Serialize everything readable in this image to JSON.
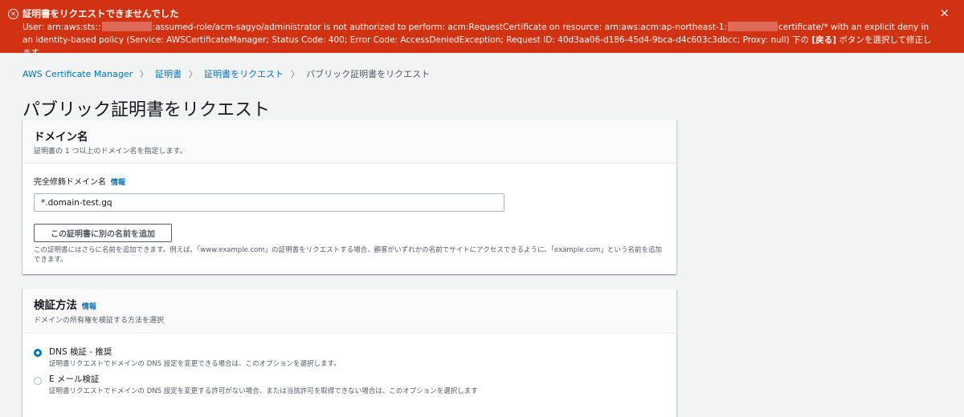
{
  "error_banner": {
    "title": "証明書をリクエストできませんでした",
    "msg_prefix": "User: arn:aws:sts::",
    "msg_mid": ":assumed-role/acm-sagyo/administrator is not authorized to perform: acm:RequestCertificate on resource: arn:aws:acm:ap-northeast-1:",
    "msg_rest": "certificate/* with an explicit deny in an identity-based policy (Service: AWSCertificateManager; Status Code: 400; Error Code: AccessDeniedException; Request ID: 40d3aa06-d186-45d4-9bca-d4c603c3dbcc; Proxy: null) 下の",
    "msg_back": "[戻る]",
    "msg_suffix": "ボタンを選択して修正します。",
    "close_icon": "×",
    "color": "#d13212"
  },
  "breadcrumb": {
    "items": [
      "AWS Certificate Manager",
      "証明書",
      "証明書をリクエスト"
    ],
    "current": "パブリック証明書をリクエスト",
    "separator": "〉"
  },
  "page": {
    "title": "パブリック証明書をリクエスト"
  },
  "domain_panel": {
    "title": "ドメイン名",
    "description": "証明書の 1 つ以上のドメイン名を指定します。",
    "field_label": "完全修飾ドメイン名",
    "info": "情報",
    "input_value": "*.domain-test.gq",
    "add_button": "この証明書に別の名前を追加",
    "help_text": "この証明書にはさらに名前を追加できます。例えば、「www.example.com」の証明書をリクエストする場合、顧客がいずれかの名前でサイトにアクセスできるように、「example.com」という名前を追加できます。"
  },
  "validation_panel": {
    "title": "検証方法",
    "info": "情報",
    "description": "ドメインの所有権を検証する方法を選択",
    "options": [
      {
        "label": "DNS 検証 - 推奨",
        "description": "証明書リクエストでドメインの DNS 設定を変更できる場合は、このオプションを選択します。",
        "selected": true
      },
      {
        "label": "E メール検証",
        "description": "証明書リクエストでドメインの DNS 設定を変更する許可がない場合、または当該許可を取得できない場合は、このオプションを選択します",
        "selected": false
      }
    ]
  }
}
